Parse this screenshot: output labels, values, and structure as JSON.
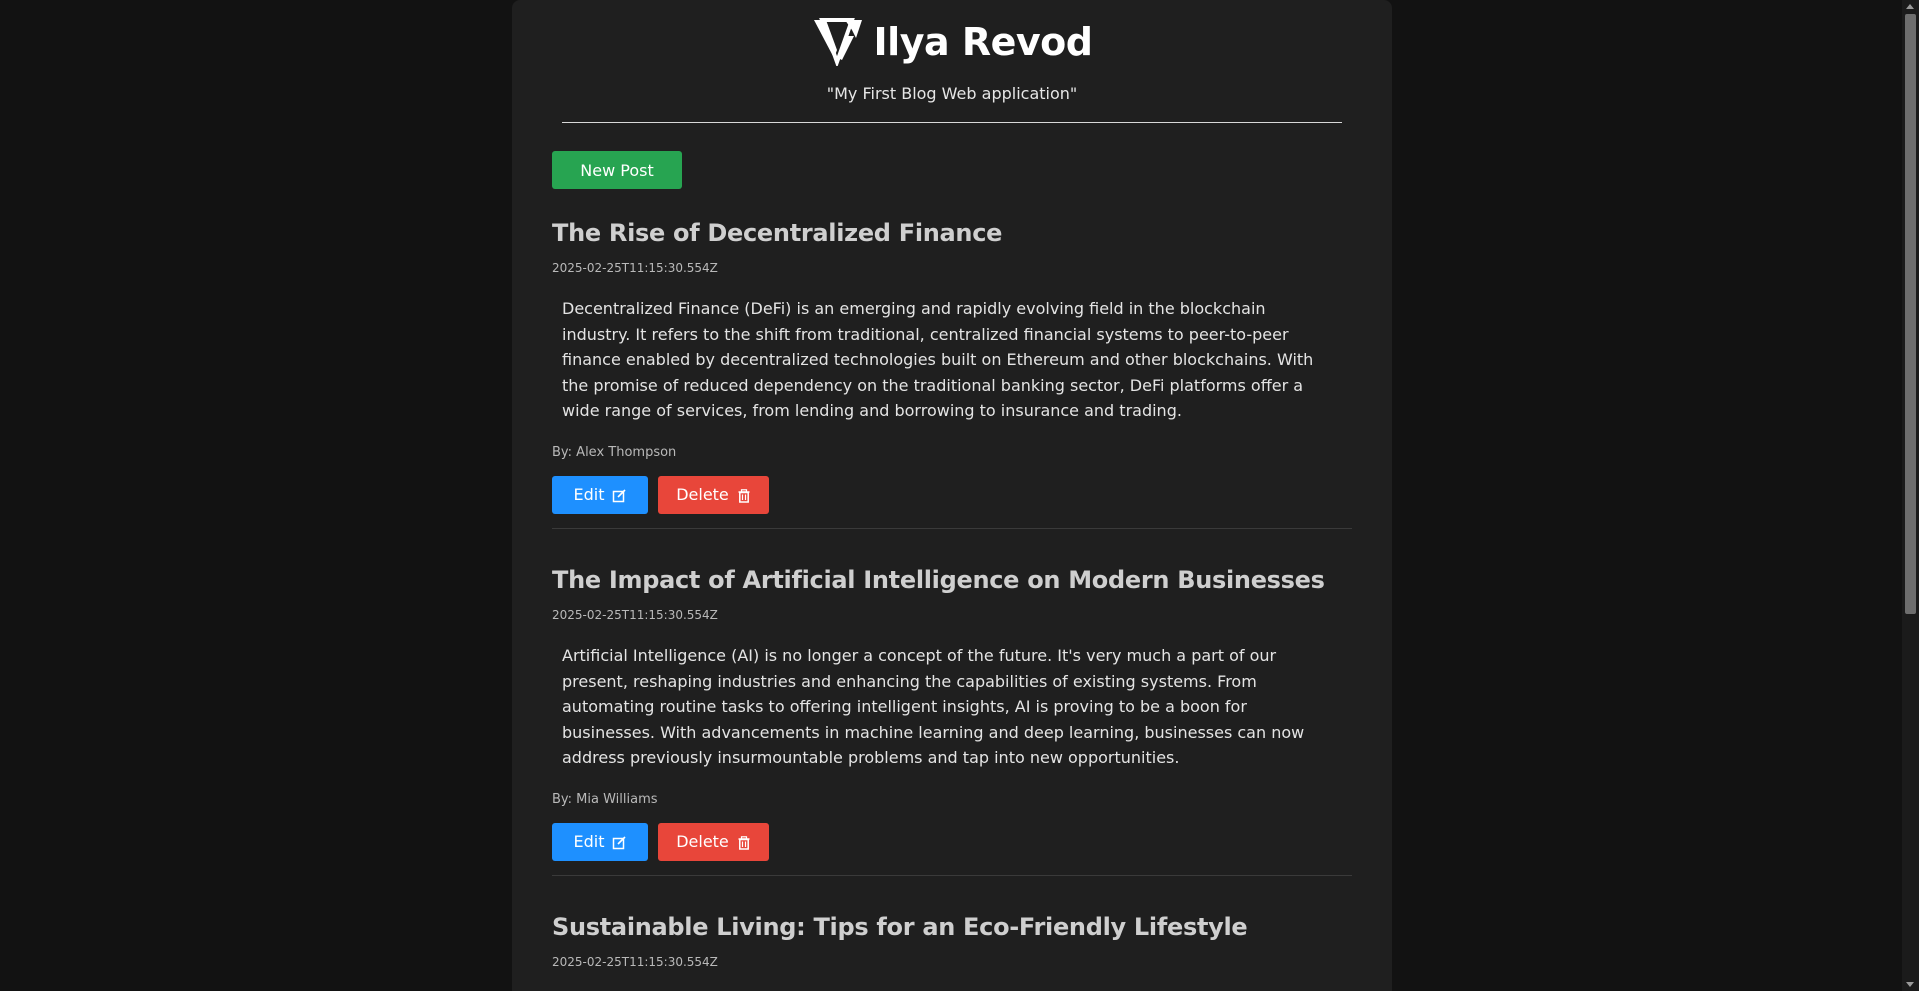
{
  "header": {
    "brand_name": "Ilya Revod",
    "tagline": "\"My First Blog Web application\""
  },
  "toolbar": {
    "new_post_label": "New Post"
  },
  "posts": [
    {
      "title": "The Rise of Decentralized Finance",
      "date": "2025-02-25T11:15:30.554Z",
      "body": "Decentralized Finance (DeFi) is an emerging and rapidly evolving field in the blockchain industry. It refers to the shift from traditional, centralized financial systems to peer-to-peer finance enabled by decentralized technologies built on Ethereum and other blockchains. With the promise of reduced dependency on the traditional banking sector, DeFi platforms offer a wide range of services, from lending and borrowing to insurance and trading.",
      "author": "By: Alex Thompson",
      "edit_label": "Edit",
      "delete_label": "Delete"
    },
    {
      "title": "The Impact of Artificial Intelligence on Modern Businesses",
      "date": "2025-02-25T11:15:30.554Z",
      "body": "Artificial Intelligence (AI) is no longer a concept of the future. It's very much a part of our present, reshaping industries and enhancing the capabilities of existing systems. From automating routine tasks to offering intelligent insights, AI is proving to be a boon for businesses. With advancements in machine learning and deep learning, businesses can now address previously insurmountable problems and tap into new opportunities.",
      "author": "By: Mia Williams",
      "edit_label": "Edit",
      "delete_label": "Delete"
    },
    {
      "title": "Sustainable Living: Tips for an Eco-Friendly Lifestyle",
      "date": "2025-02-25T11:15:30.554Z"
    }
  ],
  "icons": {
    "logo": "vi-logo-icon",
    "edit": "edit-icon",
    "delete": "trash-icon"
  },
  "colors": {
    "background": "#121212",
    "panel": "#1f1f1f",
    "new_post": "#27a451",
    "edit": "#1e90ff",
    "delete": "#e8463a"
  }
}
